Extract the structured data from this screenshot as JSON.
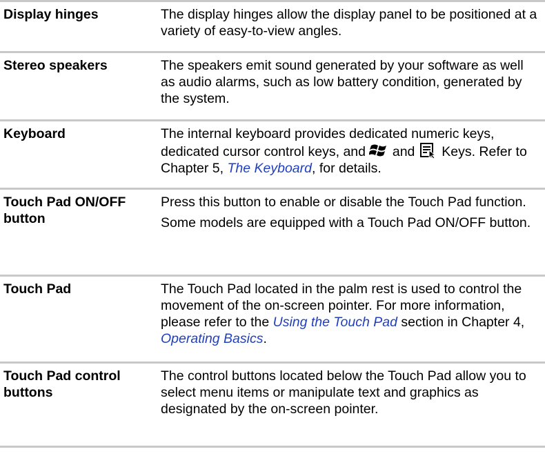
{
  "rows": [
    {
      "term": "Display hinges",
      "desc": "The display hinges allow the display panel to be positioned at a variety of easy-to-view angles."
    },
    {
      "term": "Stereo speakers",
      "desc": "The speakers emit sound generated by your software as well as audio alarms, such as low battery condition, generated by the system."
    },
    {
      "term": "Keyboard",
      "desc_a": "The internal keyboard provides dedicated numeric keys, dedicated cursor control keys, and",
      "desc_b": "and",
      "desc_c": "Keys. Refer to Chapter 5,",
      "link": "The Keyboard",
      "desc_d": ", for details.",
      "icons": [
        "windows-key-icon",
        "application-key-icon"
      ]
    },
    {
      "term": "Touch Pad ON/OFF button",
      "desc": "Press this button to enable or disable the Touch Pad function.",
      "desc2": "Some models are equipped with a Touch Pad ON/OFF button."
    },
    {
      "term": "Touch Pad",
      "desc_a": "The Touch Pad located in the palm rest is used to control the movement of the on-screen pointer. For more information, please refer to the",
      "link1": "Using the Touch Pad",
      "desc_b": "section in Chapter 4,",
      "link2": "Operating Basics",
      "desc_c": "."
    },
    {
      "term": "Touch Pad control buttons",
      "desc": "The control buttons located below the Touch Pad allow you to select menu items or manipulate text and graphics as designated by the on-screen pointer."
    }
  ]
}
